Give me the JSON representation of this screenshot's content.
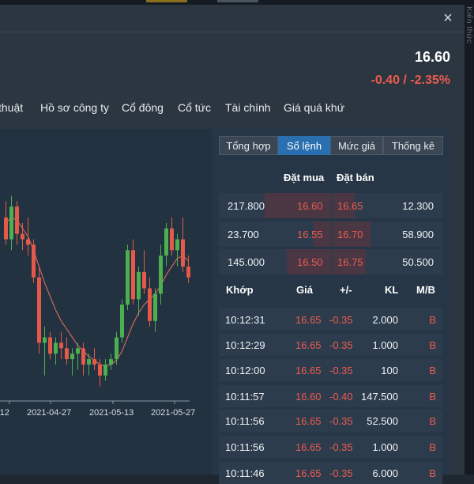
{
  "header": {
    "close_icon": "×",
    "price": "16.60",
    "change": "-0.40 / -2.35%",
    "side_label": "Kiến thức"
  },
  "tabs": [
    "thuật",
    "Hồ sơ công ty",
    "Cổ đông",
    "Cổ tức",
    "Tài chính",
    "Giá quá khứ"
  ],
  "subtabs": [
    "Tổng hợp",
    "Sổ lệnh",
    "Mức giá",
    "Thống kê"
  ],
  "active_subtab": "Sổ lệnh",
  "orderbook": {
    "headers": {
      "bid": "Đặt mua",
      "ask": "Đặt bán"
    },
    "rows": [
      {
        "bid_vol": "217.800",
        "bid_price": "16.60",
        "ask_price": "16.65",
        "ask_vol": "12.300"
      },
      {
        "bid_vol": "23.700",
        "bid_price": "16.55",
        "ask_price": "16.70",
        "ask_vol": "58.900"
      },
      {
        "bid_vol": "145.000",
        "bid_price": "16.50",
        "ask_price": "16.75",
        "ask_vol": "50.500"
      }
    ]
  },
  "matches": {
    "headers": {
      "time": "Khớp",
      "price": "Giá",
      "change": "+/-",
      "volume": "KL",
      "side": "M/B"
    },
    "rows": [
      {
        "time": "10:12:31",
        "price": "16.65",
        "change": "-0.35",
        "volume": "2.000",
        "side": "B"
      },
      {
        "time": "10:12:29",
        "price": "16.65",
        "change": "-0.35",
        "volume": "1.000",
        "side": "B"
      },
      {
        "time": "10:12:00",
        "price": "16.65",
        "change": "-0.35",
        "volume": "100",
        "side": "B"
      },
      {
        "time": "10:11:57",
        "price": "16.60",
        "change": "-0.40",
        "volume": "147.500",
        "side": "B"
      },
      {
        "time": "10:11:56",
        "price": "16.65",
        "change": "-0.35",
        "volume": "52.500",
        "side": "B"
      },
      {
        "time": "10:11:56",
        "price": "16.65",
        "change": "-0.35",
        "volume": "1.000",
        "side": "B"
      },
      {
        "time": "10:11:46",
        "price": "16.65",
        "change": "-0.35",
        "volume": "6.000",
        "side": "B"
      }
    ]
  },
  "chart_data": {
    "type": "candlestick",
    "x_tick_labels": [
      "-12",
      "2021-04-27",
      "2021-05-13",
      "2021-05-27"
    ],
    "colors": {
      "up": "#4caf50",
      "down": "#e5594a",
      "ma": "#c96a5c"
    },
    "candles": [
      {
        "o": 16.9,
        "h": 17.2,
        "l": 16.4,
        "c": 16.5
      },
      {
        "o": 16.5,
        "h": 17.3,
        "l": 16.3,
        "c": 17.1
      },
      {
        "o": 17.1,
        "h": 17.2,
        "l": 16.4,
        "c": 16.6
      },
      {
        "o": 16.6,
        "h": 16.8,
        "l": 16.3,
        "c": 16.5
      },
      {
        "o": 16.5,
        "h": 16.9,
        "l": 16.2,
        "c": 16.4
      },
      {
        "o": 16.4,
        "h": 16.5,
        "l": 15.7,
        "c": 15.8
      },
      {
        "o": 15.8,
        "h": 16.0,
        "l": 14.4,
        "c": 14.6
      },
      {
        "o": 14.6,
        "h": 14.9,
        "l": 14.0,
        "c": 14.7
      },
      {
        "o": 14.7,
        "h": 14.8,
        "l": 14.3,
        "c": 14.4
      },
      {
        "o": 14.4,
        "h": 14.7,
        "l": 14.2,
        "c": 14.6
      },
      {
        "o": 14.6,
        "h": 14.8,
        "l": 14.3,
        "c": 14.5
      },
      {
        "o": 14.5,
        "h": 14.7,
        "l": 14.2,
        "c": 14.3
      },
      {
        "o": 14.3,
        "h": 14.5,
        "l": 14.0,
        "c": 14.4
      },
      {
        "o": 14.4,
        "h": 14.6,
        "l": 14.1,
        "c": 14.5
      },
      {
        "o": 14.5,
        "h": 14.6,
        "l": 14.0,
        "c": 14.2
      },
      {
        "o": 14.2,
        "h": 14.4,
        "l": 14.0,
        "c": 14.3
      },
      {
        "o": 14.3,
        "h": 14.5,
        "l": 14.1,
        "c": 14.2
      },
      {
        "o": 14.2,
        "h": 14.3,
        "l": 13.8,
        "c": 14.0
      },
      {
        "o": 14.0,
        "h": 14.3,
        "l": 13.9,
        "c": 14.2
      },
      {
        "o": 14.2,
        "h": 14.4,
        "l": 14.1,
        "c": 14.3
      },
      {
        "o": 14.3,
        "h": 14.8,
        "l": 14.2,
        "c": 14.7
      },
      {
        "o": 14.7,
        "h": 15.4,
        "l": 14.6,
        "c": 15.3
      },
      {
        "o": 15.3,
        "h": 16.4,
        "l": 15.2,
        "c": 16.3
      },
      {
        "o": 16.3,
        "h": 16.5,
        "l": 15.3,
        "c": 15.4
      },
      {
        "o": 15.4,
        "h": 16.0,
        "l": 15.1,
        "c": 15.9
      },
      {
        "o": 15.9,
        "h": 16.3,
        "l": 15.5,
        "c": 15.6
      },
      {
        "o": 15.6,
        "h": 15.8,
        "l": 14.9,
        "c": 15.0
      },
      {
        "o": 15.0,
        "h": 15.6,
        "l": 14.8,
        "c": 15.5
      },
      {
        "o": 15.5,
        "h": 16.4,
        "l": 15.3,
        "c": 16.2
      },
      {
        "o": 16.2,
        "h": 16.8,
        "l": 16.0,
        "c": 16.7
      },
      {
        "o": 16.7,
        "h": 16.9,
        "l": 16.2,
        "c": 16.3
      },
      {
        "o": 16.3,
        "h": 16.6,
        "l": 16.0,
        "c": 16.5
      },
      {
        "o": 16.5,
        "h": 16.9,
        "l": 15.9,
        "c": 16.0
      },
      {
        "o": 16.0,
        "h": 16.2,
        "l": 15.7,
        "c": 15.8
      }
    ],
    "ma": [
      16.8,
      16.9,
      16.85,
      16.7,
      16.55,
      16.3,
      16.0,
      15.7,
      15.45,
      15.2,
      15.0,
      14.85,
      14.7,
      14.55,
      14.45,
      14.35,
      14.28,
      14.2,
      14.18,
      14.2,
      14.28,
      14.45,
      14.7,
      14.95,
      15.15,
      15.3,
      15.4,
      15.5,
      15.65,
      15.85,
      16.0,
      16.15,
      16.2,
      16.1
    ]
  }
}
